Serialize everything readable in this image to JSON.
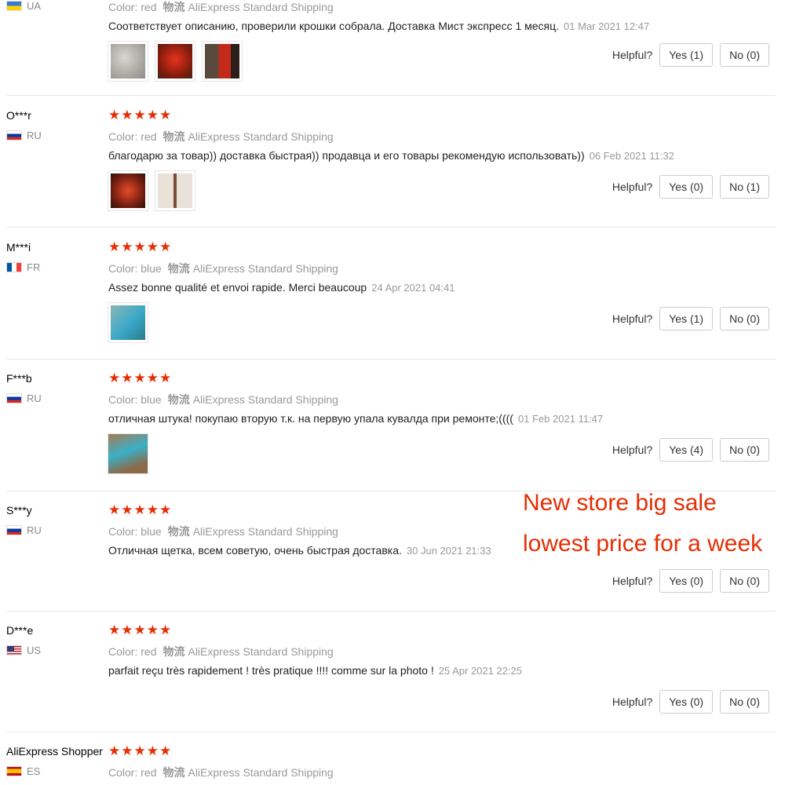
{
  "labels": {
    "color_prefix": "Color:",
    "logistics": "物流",
    "shipping": "AliExpress Standard Shipping",
    "helpful": "Helpful?",
    "stars": "★★★★★"
  },
  "promo": {
    "line1": "New store big sale",
    "line2": "lowest price for a week"
  },
  "reviews": [
    {
      "user": "",
      "country": "UA",
      "flag": "ua",
      "color": "red",
      "text": "Соответствует описанию, проверили крошки собрала. Доставка Мист экспресс 1 месяц.",
      "date": "01 Mar 2021 12:47",
      "yes": "Yes (1)",
      "no": "No (0)",
      "photos": [
        "gray",
        "red",
        "redmop"
      ]
    },
    {
      "user": "O***r",
      "country": "RU",
      "flag": "ru",
      "color": "red",
      "text": "благодарю за товар)) доставка быстрая)) продавца и его товары рекомендую использовать))",
      "date": "06 Feb 2021 11:32",
      "yes": "Yes (0)",
      "no": "No (1)",
      "photos": [
        "redd",
        "pole"
      ]
    },
    {
      "user": "M***i",
      "country": "FR",
      "flag": "fr",
      "color": "blue",
      "text": "Assez bonne qualité et envoi rapide. Merci beaucoup",
      "date": "24 Apr 2021 04:41",
      "yes": "Yes (1)",
      "no": "No (0)",
      "photos": [
        "blue"
      ]
    },
    {
      "user": "F***b",
      "country": "RU",
      "flag": "ru",
      "color": "blue",
      "text": "отличная штука! покупаю вторую т.к. на первую упала кувалда при ремонте;((((",
      "date": "01 Feb 2021 11:47",
      "yes": "Yes (4)",
      "no": "No (0)",
      "photos": [
        "bluefloor"
      ]
    },
    {
      "user": "S***y",
      "country": "RU",
      "flag": "ru",
      "color": "blue",
      "text": "Отличная щетка, всем советую, очень быстрая доставка.",
      "date": "30 Jun 2021 21:33",
      "yes": "Yes (0)",
      "no": "No (0)",
      "photos": []
    },
    {
      "user": "D***e",
      "country": "US",
      "flag": "us",
      "color": "red",
      "text": "parfait reçu très rapidement ! très pratique !!!! comme sur la photo !",
      "date": "25 Apr 2021 22:25",
      "yes": "Yes (0)",
      "no": "No (0)",
      "photos": []
    },
    {
      "user": "AliExpress Shopper",
      "country": "ES",
      "flag": "es",
      "color": "red",
      "text": "",
      "date": "",
      "yes": "",
      "no": "",
      "photos": []
    }
  ]
}
